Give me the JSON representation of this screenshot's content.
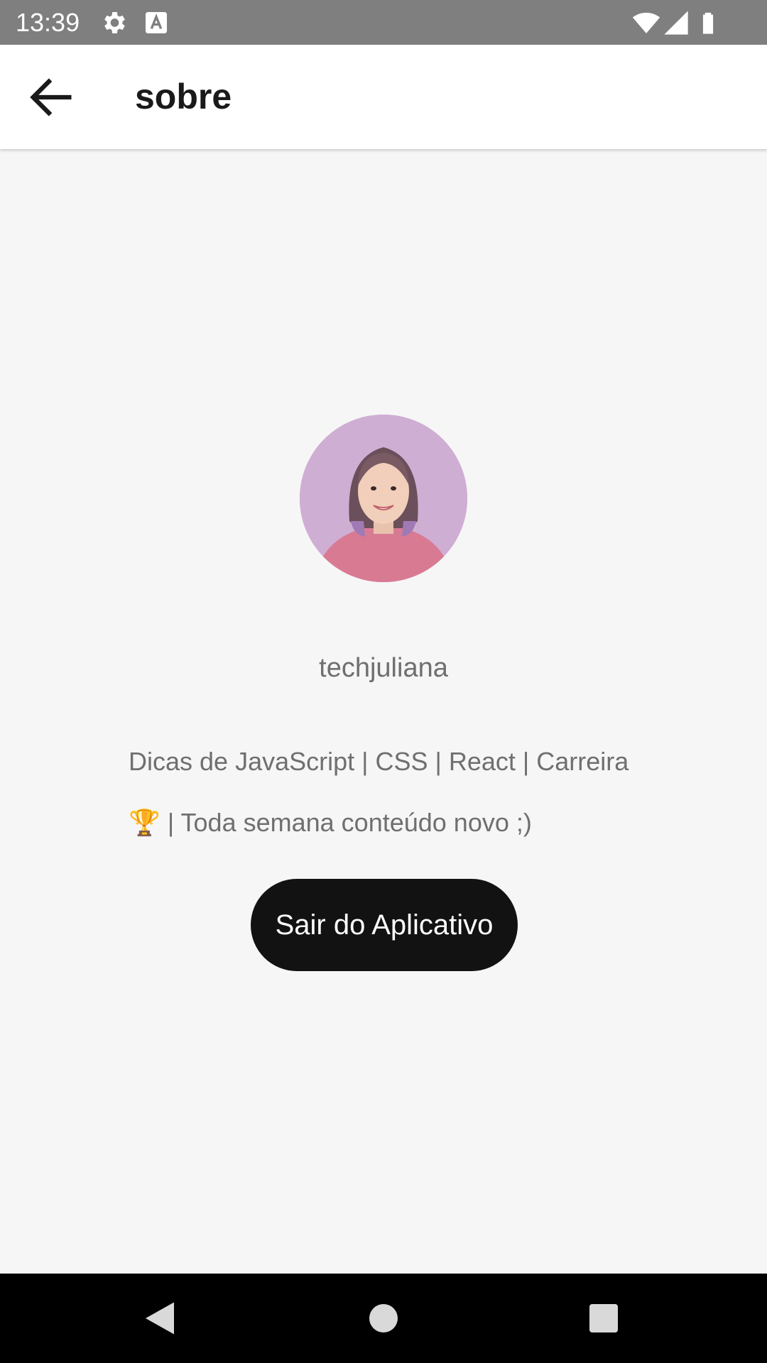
{
  "status_bar": {
    "time": "13:39",
    "icons": [
      "gear-icon",
      "a-notification-icon",
      "wifi-icon",
      "signal-icon",
      "battery-icon"
    ],
    "background": "#7f7f7f"
  },
  "app_bar": {
    "title": "sobre",
    "back_icon": "arrow-left-icon"
  },
  "profile": {
    "avatar": "profile-photo",
    "username": "techjuliana",
    "bio_line_1": "Dicas de JavaScript | CSS | React | Carreira",
    "bio_line_2": "🏆 | Toda semana conteúdo novo ;)"
  },
  "actions": {
    "exit_label": "Sair do Aplicativo",
    "exit_color": "#121212"
  },
  "navigation_bar": {
    "buttons": [
      "back-triangle-icon",
      "home-circle-icon",
      "recents-square-icon"
    ]
  }
}
